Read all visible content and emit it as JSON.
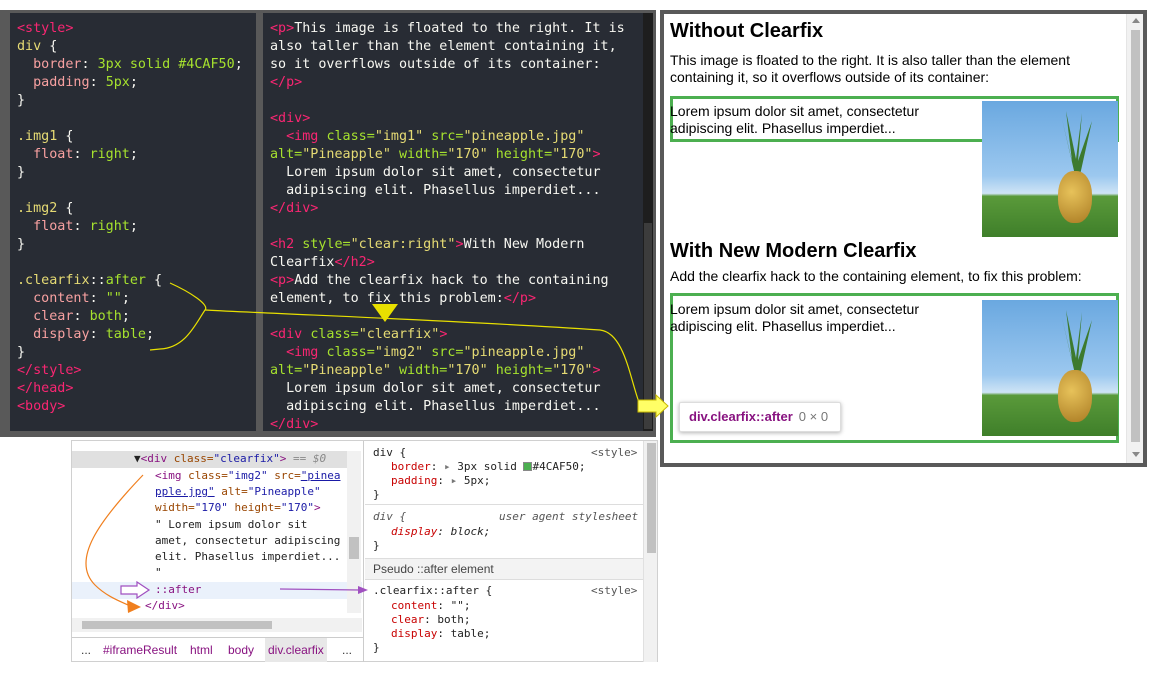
{
  "css_code": {
    "lines": [
      [
        {
          "t": "<style>",
          "c": "c-tag"
        }
      ],
      [
        {
          "t": "div",
          "c": "c-sel"
        },
        {
          "t": " {",
          "c": "c-txt"
        }
      ],
      [
        {
          "t": "  border",
          "c": "c-prop"
        },
        {
          "t": ": ",
          "c": "c-txt"
        },
        {
          "t": "3px solid #4CAF50",
          "c": "c-val"
        },
        {
          "t": ";",
          "c": "c-txt"
        }
      ],
      [
        {
          "t": "  padding",
          "c": "c-prop"
        },
        {
          "t": ": ",
          "c": "c-txt"
        },
        {
          "t": "5px",
          "c": "c-val"
        },
        {
          "t": ";",
          "c": "c-txt"
        }
      ],
      [
        {
          "t": "}",
          "c": "c-txt"
        }
      ],
      [
        {
          "t": "",
          "c": "c-txt"
        }
      ],
      [
        {
          "t": ".img1",
          "c": "c-sel"
        },
        {
          "t": " {",
          "c": "c-txt"
        }
      ],
      [
        {
          "t": "  float",
          "c": "c-prop"
        },
        {
          "t": ": ",
          "c": "c-txt"
        },
        {
          "t": "right",
          "c": "c-val"
        },
        {
          "t": ";",
          "c": "c-txt"
        }
      ],
      [
        {
          "t": "}",
          "c": "c-txt"
        }
      ],
      [
        {
          "t": "",
          "c": "c-txt"
        }
      ],
      [
        {
          "t": ".img2",
          "c": "c-sel"
        },
        {
          "t": " {",
          "c": "c-txt"
        }
      ],
      [
        {
          "t": "  float",
          "c": "c-prop"
        },
        {
          "t": ": ",
          "c": "c-txt"
        },
        {
          "t": "right",
          "c": "c-val"
        },
        {
          "t": ";",
          "c": "c-txt"
        }
      ],
      [
        {
          "t": "}",
          "c": "c-txt"
        }
      ],
      [
        {
          "t": "",
          "c": "c-txt"
        }
      ],
      [
        {
          "t": ".clearfix",
          "c": "c-sel"
        },
        {
          "t": "::",
          "c": "c-txt"
        },
        {
          "t": "after",
          "c": "c-pseudo"
        },
        {
          "t": " {",
          "c": "c-txt"
        }
      ],
      [
        {
          "t": "  content",
          "c": "c-prop"
        },
        {
          "t": ": ",
          "c": "c-txt"
        },
        {
          "t": "\"\"",
          "c": "c-val"
        },
        {
          "t": ";",
          "c": "c-txt"
        }
      ],
      [
        {
          "t": "  clear",
          "c": "c-prop"
        },
        {
          "t": ": ",
          "c": "c-txt"
        },
        {
          "t": "both",
          "c": "c-val"
        },
        {
          "t": ";",
          "c": "c-txt"
        }
      ],
      [
        {
          "t": "  display",
          "c": "c-prop"
        },
        {
          "t": ": ",
          "c": "c-txt"
        },
        {
          "t": "table",
          "c": "c-val"
        },
        {
          "t": ";",
          "c": "c-txt"
        }
      ],
      [
        {
          "t": "}",
          "c": "c-txt"
        }
      ],
      [
        {
          "t": "</style>",
          "c": "c-tag"
        }
      ],
      [
        {
          "t": "</head>",
          "c": "c-tag"
        }
      ],
      [
        {
          "t": "<body>",
          "c": "c-tag"
        }
      ]
    ]
  },
  "html_code": {
    "lines": [
      [
        {
          "t": "<p>",
          "c": "c-tag"
        },
        {
          "t": "This image is floated to the right. It is",
          "c": "c-txt"
        }
      ],
      [
        {
          "t": "also taller than the element containing it,",
          "c": "c-txt"
        }
      ],
      [
        {
          "t": "so it overflows outside of its container:",
          "c": "c-txt"
        }
      ],
      [
        {
          "t": "</p>",
          "c": "c-tag"
        }
      ],
      [
        {
          "t": "",
          "c": "c-txt"
        }
      ],
      [
        {
          "t": "<div>",
          "c": "c-tag"
        }
      ],
      [
        {
          "t": "  <img ",
          "c": "c-tag"
        },
        {
          "t": "class=",
          "c": "c-attr"
        },
        {
          "t": "\"img1\"",
          "c": "c-str"
        },
        {
          "t": " src=",
          "c": "c-attr"
        },
        {
          "t": "\"pineapple.jpg\"",
          "c": "c-str"
        }
      ],
      [
        {
          "t": "alt=",
          "c": "c-attr"
        },
        {
          "t": "\"Pineapple\"",
          "c": "c-str"
        },
        {
          "t": " width=",
          "c": "c-attr"
        },
        {
          "t": "\"170\"",
          "c": "c-str"
        },
        {
          "t": " height=",
          "c": "c-attr"
        },
        {
          "t": "\"170\"",
          "c": "c-str"
        },
        {
          "t": ">",
          "c": "c-tag"
        }
      ],
      [
        {
          "t": "  Lorem ipsum dolor sit amet, consectetur",
          "c": "c-txt"
        }
      ],
      [
        {
          "t": "  adipiscing elit. Phasellus imperdiet...",
          "c": "c-txt"
        }
      ],
      [
        {
          "t": "</div>",
          "c": "c-tag"
        }
      ],
      [
        {
          "t": "",
          "c": "c-txt"
        }
      ],
      [
        {
          "t": "<h2 ",
          "c": "c-tag"
        },
        {
          "t": "style=",
          "c": "c-attr"
        },
        {
          "t": "\"clear:right\"",
          "c": "c-str"
        },
        {
          "t": ">",
          "c": "c-tag"
        },
        {
          "t": "With New Modern",
          "c": "c-txt"
        }
      ],
      [
        {
          "t": "Clearfix",
          "c": "c-txt"
        },
        {
          "t": "</h2>",
          "c": "c-tag"
        }
      ],
      [
        {
          "t": "<p>",
          "c": "c-tag"
        },
        {
          "t": "Add the clearfix hack to the containing",
          "c": "c-txt"
        }
      ],
      [
        {
          "t": "element, to fix this problem:",
          "c": "c-txt"
        },
        {
          "t": "</p>",
          "c": "c-tag"
        }
      ],
      [
        {
          "t": "",
          "c": "c-txt"
        }
      ],
      [
        {
          "t": "<div ",
          "c": "c-tag"
        },
        {
          "t": "class=",
          "c": "c-attr"
        },
        {
          "t": "\"clearfix\"",
          "c": "c-str"
        },
        {
          "t": ">",
          "c": "c-tag"
        }
      ],
      [
        {
          "t": "  <img ",
          "c": "c-tag"
        },
        {
          "t": "class=",
          "c": "c-attr"
        },
        {
          "t": "\"img2\"",
          "c": "c-str"
        },
        {
          "t": " src=",
          "c": "c-attr"
        },
        {
          "t": "\"pineapple.jpg\"",
          "c": "c-str"
        }
      ],
      [
        {
          "t": "alt=",
          "c": "c-attr"
        },
        {
          "t": "\"Pineapple\"",
          "c": "c-str"
        },
        {
          "t": " width=",
          "c": "c-attr"
        },
        {
          "t": "\"170\"",
          "c": "c-str"
        },
        {
          "t": " height=",
          "c": "c-attr"
        },
        {
          "t": "\"170\"",
          "c": "c-str"
        },
        {
          "t": ">",
          "c": "c-tag"
        }
      ],
      [
        {
          "t": "  Lorem ipsum dolor sit amet, consectetur",
          "c": "c-txt"
        }
      ],
      [
        {
          "t": "  adipiscing elit. Phasellus imperdiet...",
          "c": "c-txt"
        }
      ],
      [
        {
          "t": "</div>",
          "c": "c-tag"
        }
      ]
    ]
  },
  "result": {
    "h1": "Without Clearfix",
    "p1_line1": "This image is floated to the right. It is also taller than the element",
    "p1_line2": "containing it, so it overflows outside of its container:",
    "box1_line1": "Lorem ipsum dolor sit amet, consectetur",
    "box1_line2": "adipiscing elit. Phasellus imperdiet...",
    "h2": "With New Modern Clearfix",
    "p2": "Add the clearfix hack to the containing element, to fix this problem:",
    "box2_line1": "Lorem ipsum dolor sit amet, consectetur",
    "box2_line2": "adipiscing elit. Phasellus imperdiet...",
    "tooltip_name": "div.clearfix::after",
    "tooltip_size": "0 × 0"
  },
  "dom": {
    "l1_tag": "<div ",
    "l1_attr": "class=",
    "l1_val": "\"clearfix\"",
    "l1_close": ">",
    "l1_eq": " == $0",
    "l2a": "<img ",
    "l2b": "class=",
    "l2c": "\"img2\"",
    "l2d": " src=",
    "l2e": "\"pinea",
    "l3a": "pple.jpg\"",
    "l3b": " alt=",
    "l3c": "\"Pineapple\"",
    "l4a": "width=",
    "l4b": "\"170\"",
    "l4c": " height=",
    "l4d": "\"170\"",
    "l4e": ">",
    "l5": "\" Lorem ipsum dolor sit",
    "l6": "amet, consectetur adipiscing",
    "l7": "elit. Phasellus imperdiet...",
    "l8": "\"",
    "l9": "::after",
    "l10": "</div>"
  },
  "breadcrumb": [
    "...",
    "#iframeResult",
    "html",
    "body",
    "div.clearfix",
    "..."
  ],
  "styles": {
    "r1_sel": "div {",
    "r1_src": "<style>",
    "r1_p1": "border",
    "r1_v1a": "3px solid ",
    "r1_v1b": "#4CAF50;",
    "r1_p2": "padding",
    "r1_v2": "5px;",
    "r1_close": "}",
    "r2_sel": "div {",
    "r2_src": "user agent stylesheet",
    "r2_p1": "display",
    "r2_v1": "block;",
    "r2_close": "}",
    "pseudo_header": "Pseudo ::after element",
    "r3_sel": ".clearfix::after {",
    "r3_src": "<style>",
    "r3_p1": "content",
    "r3_v1": "\"\";",
    "r3_p2": "clear",
    "r3_v2": "both;",
    "r3_p3": "display",
    "r3_v3": "table;",
    "r3_close": "}"
  },
  "colors": {
    "accent": "#4CAF50",
    "editor_bg": "#282c34",
    "annotation_yellow": "#e8e000",
    "annotation_orange": "#f07f1e",
    "annotation_purple": "#a050c0"
  }
}
